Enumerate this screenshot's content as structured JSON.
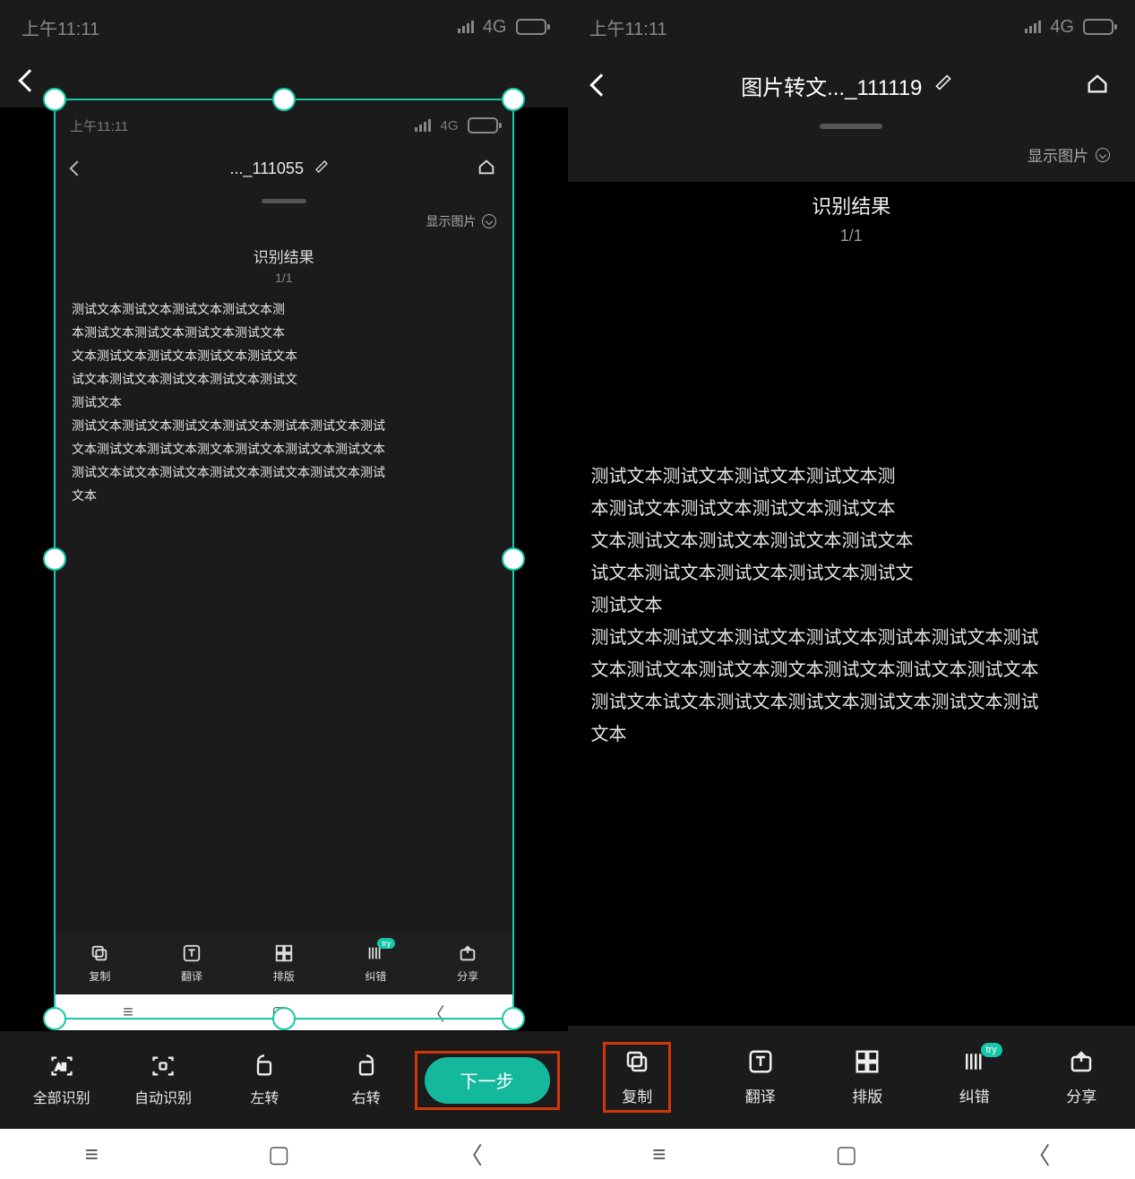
{
  "left": {
    "status": {
      "time": "上午11:11",
      "net": "4G"
    },
    "inner": {
      "status_time": "上午11:11",
      "status_net": "4G",
      "title": "..._111055",
      "show_image": "显示图片",
      "result_heading": "识别结果",
      "result_page": "1/1",
      "lines": [
        "测试文本测试文本测试文本测试文本测",
        "本测试文本测试文本测试文本测试文本",
        "文本测试文本测试文本测试文本测试文本",
        "试文本测试文本测试文本测试文本测试文",
        "测试文本",
        "测试文本测试文本测试文本测试文本测试本测试文本测试",
        "文本测试文本测试文本测文本测试文本测试文本测试文本",
        "测试文本试文本测试文本测试文本测试文本测试文本测试",
        "文本"
      ],
      "toolbar": {
        "copy": "复制",
        "translate": "翻译",
        "layout": "排版",
        "correct": "纠错",
        "share": "分享",
        "try_badge": "try"
      }
    },
    "bottom_toolbar": {
      "recognize_all": "全部识别",
      "auto_recognize": "自动识别",
      "rotate_left": "左转",
      "rotate_right": "右转",
      "next": "下一步"
    }
  },
  "right": {
    "status": {
      "time": "上午11:11",
      "net": "4G"
    },
    "title": "图片转文..._111119",
    "show_image": "显示图片",
    "result_heading": "识别结果",
    "result_page": "1/1",
    "lines": [
      "测试文本测试文本测试文本测试文本测",
      "本测试文本测试文本测试文本测试文本",
      "文本测试文本测试文本测试文本测试文本",
      "试文本测试文本测试文本测试文本测试文",
      "测试文本",
      "测试文本测试文本测试文本测试文本测试本测试文本测试",
      "文本测试文本测试文本测文本测试文本测试文本测试文本",
      "测试文本试文本测试文本测试文本测试文本测试文本测试",
      "文本"
    ],
    "toolbar": {
      "copy": "复制",
      "translate": "翻译",
      "layout": "排版",
      "correct": "纠错",
      "share": "分享",
      "try_badge": "try"
    }
  }
}
